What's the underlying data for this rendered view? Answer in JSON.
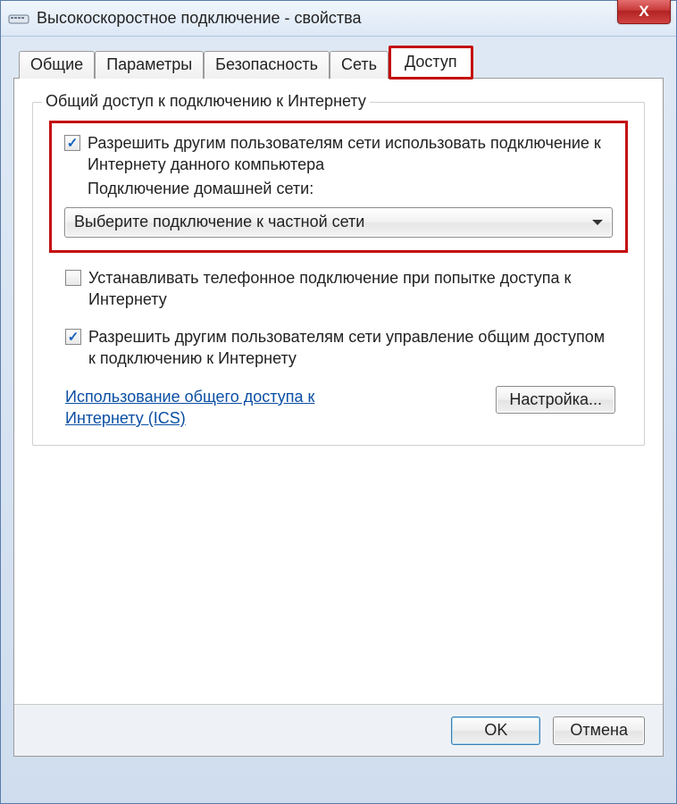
{
  "window": {
    "title": "Высокоскоростное подключение - свойства",
    "close_label": "X"
  },
  "tabs": {
    "general": "Общие",
    "parameters": "Параметры",
    "security": "Безопасность",
    "network": "Сеть",
    "sharing": "Доступ"
  },
  "group": {
    "title": "Общий доступ к подключению к Интернету"
  },
  "allow_share": {
    "checked": true,
    "text": "Разрешить другим пользователям сети использовать подключение к Интернету данного компьютера",
    "sub_label": "Подключение домашней сети:"
  },
  "combo": {
    "selected": "Выберите подключение к частной сети"
  },
  "dial_on_demand": {
    "checked": false,
    "text": "Устанавливать телефонное подключение при попытке доступа к Интернету"
  },
  "allow_control": {
    "checked": true,
    "text": "Разрешить другим пользователям сети управление общим доступом к подключению к Интернету"
  },
  "link": {
    "text": "Использование общего доступа к Интернету (ICS)"
  },
  "buttons": {
    "settings": "Настройка...",
    "ok": "OK",
    "cancel": "Отмена"
  }
}
